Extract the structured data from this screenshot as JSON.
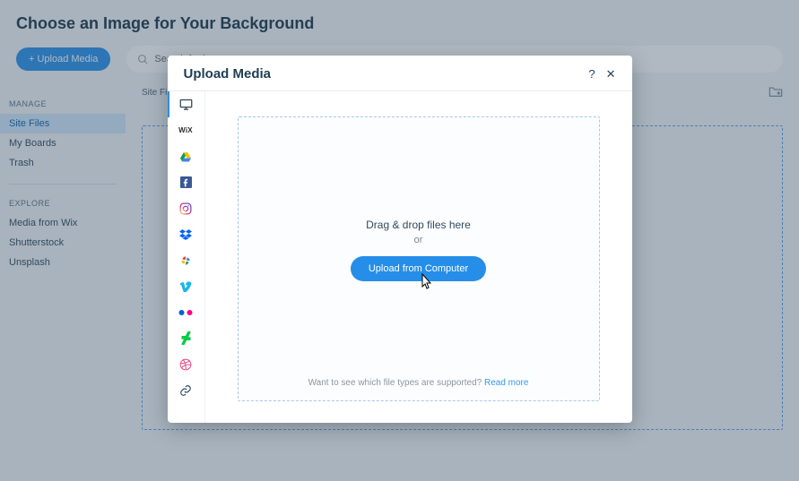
{
  "page_title": "Choose an Image for Your Background",
  "upload_button": "+ Upload Media",
  "search_placeholder": "Search for bu",
  "sidebar": {
    "manage_header": "MANAGE",
    "manage_items": [
      "Site Files",
      "My Boards",
      "Trash"
    ],
    "explore_header": "EXPLORE",
    "explore_items": [
      "Media from Wix",
      "Shutterstock",
      "Unsplash"
    ],
    "active_index": 0
  },
  "breadcrumb": "Site Files",
  "modal": {
    "title": "Upload Media",
    "sources": {
      "computer": "computer",
      "wix": "WiX"
    },
    "drag_text": "Drag & drop files here",
    "or_text": "or",
    "upload_from_computer": "Upload from Computer",
    "support_text": "Want to see which file types are supported? ",
    "read_more": "Read more"
  }
}
